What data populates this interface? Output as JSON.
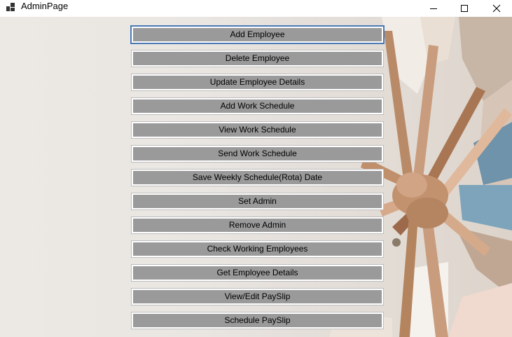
{
  "window": {
    "title": "AdminPage",
    "controls": [
      "minimize-icon",
      "maximize-icon",
      "close-icon"
    ]
  },
  "buttons": [
    "Add Employee",
    "Delete Employee",
    "Update Employee Details",
    "Add Work Schedule",
    "View Work Schedule",
    "Send Work Schedule",
    "Save Weekly Schedule(Rota) Date",
    "Set Admin",
    "Remove Admin",
    "Check Working Employees",
    "Get Employee Details",
    "View/Edit PaySlip",
    "Schedule PaySlip"
  ],
  "colors": {
    "button_face": "#9a9a9a",
    "focus_ring": "#4a79b5",
    "background": "#ece8e4"
  }
}
